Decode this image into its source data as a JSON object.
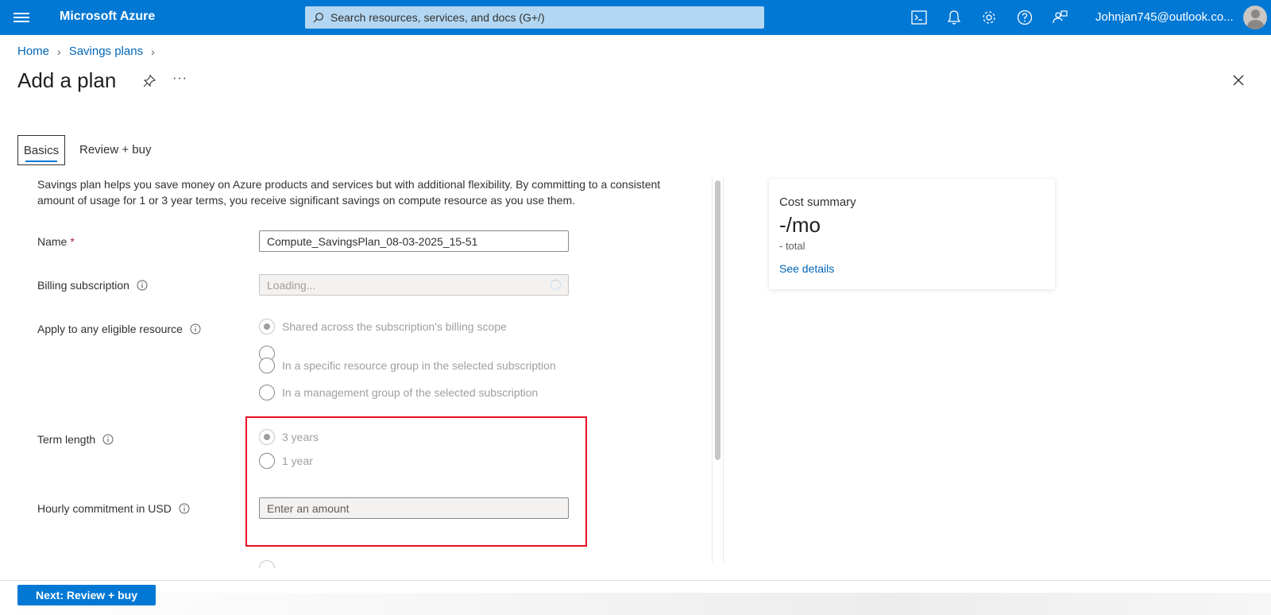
{
  "topbar": {
    "brand": "Microsoft Azure",
    "search_placeholder": "Search resources, services, and docs (G+/)",
    "account": "Johnjan745@outlook.co..."
  },
  "breadcrumb": {
    "home": "Home",
    "savings_plans": "Savings plans"
  },
  "page": {
    "title": "Add a plan",
    "more": "···"
  },
  "tabs": {
    "basics": "Basics",
    "review": "Review + buy"
  },
  "intro": "Savings plan helps you save money on Azure products and services but with additional flexibility. By committing to a consistent amount of usage for 1 or 3 year terms, you receive significant savings on compute resource as you use them.",
  "form": {
    "name": {
      "label": "Name",
      "required": "*",
      "value": "Compute_SavingsPlan_08-03-2025_15-51"
    },
    "billing": {
      "label": "Billing subscription",
      "value": "Loading..."
    },
    "apply": {
      "label": "Apply to any eligible resource",
      "options": [
        "Shared across the subscription's billing scope",
        "In a specific resource group in the selected subscription",
        "In a management group of the selected subscription"
      ]
    },
    "term": {
      "label": "Term length",
      "options": [
        "3 years",
        "1 year"
      ]
    },
    "commitment": {
      "label": "Hourly commitment in USD",
      "placeholder": "Enter an amount"
    }
  },
  "cost_summary": {
    "title": "Cost summary",
    "value": "-/mo",
    "sub": "- total",
    "link": "See details"
  },
  "footer": {
    "next": "Next: Review + buy"
  }
}
